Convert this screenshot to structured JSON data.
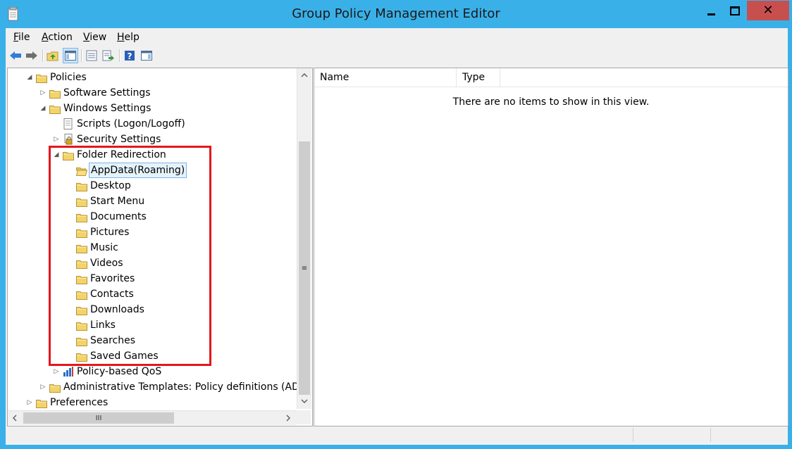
{
  "window": {
    "title": "Group Policy Management Editor",
    "close_glyph": "✕"
  },
  "menu": {
    "file": {
      "key": "F",
      "rest": "ile"
    },
    "action": {
      "key": "A",
      "rest": "ction"
    },
    "view": {
      "key": "V",
      "rest": "iew"
    },
    "help": {
      "key": "H",
      "rest": "elp"
    }
  },
  "toolbar": {
    "icons": [
      "back-arrow-icon",
      "forward-arrow-icon",
      "up-folder-icon",
      "show-hide-tree-icon",
      "properties-icon",
      "export-list-icon",
      "help-icon",
      "show-hide-action-pane-icon"
    ]
  },
  "tree": {
    "policies": "Policies",
    "software_settings": "Software Settings",
    "windows_settings": "Windows Settings",
    "scripts": "Scripts (Logon/Logoff)",
    "security_settings": "Security Settings",
    "folder_redirection": "Folder Redirection",
    "folders": [
      "AppData(Roaming)",
      "Desktop",
      "Start Menu",
      "Documents",
      "Pictures",
      "Music",
      "Videos",
      "Favorites",
      "Contacts",
      "Downloads",
      "Links",
      "Searches",
      "Saved Games"
    ],
    "policy_qos": "Policy-based QoS",
    "admin_templates": "Administrative Templates: Policy definitions (ADM",
    "preferences": "Preferences",
    "expander_collapsed": "▷",
    "expander_expanded": "◢"
  },
  "list": {
    "columns": [
      "Name",
      "Type"
    ],
    "empty_message": "There are no items to show in this view."
  },
  "scrollbar": {
    "v_grip": "≡",
    "h_grip": "III"
  },
  "colors": {
    "titlebar": "#3ab0e8",
    "close_button": "#c7504f",
    "highlight_box": "#e5161d",
    "folder_yellow": "#f3d46a",
    "selection_border": "#7eb4ea"
  }
}
